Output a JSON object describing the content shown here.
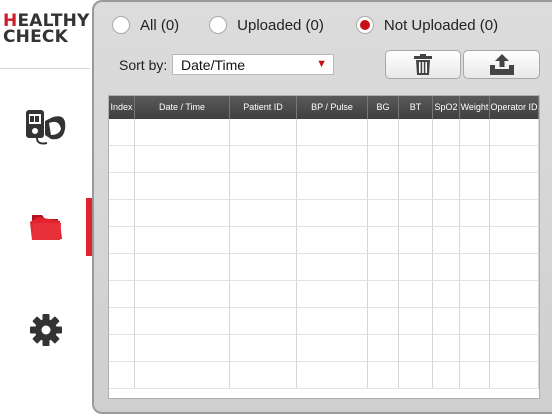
{
  "logo": {
    "first_letter": "H",
    "line1_rest": "EALTHY",
    "line2": "CHECK"
  },
  "nav": [
    {
      "name": "meter",
      "icon": "blood-pressure-meter-icon",
      "active": false
    },
    {
      "name": "records",
      "icon": "folder-icon",
      "active": true
    },
    {
      "name": "settings",
      "icon": "gear-icon",
      "active": false
    }
  ],
  "filters": {
    "all": "All (0)",
    "uploaded": "Uploaded (0)",
    "not_uploaded": "Not Uploaded (0)",
    "selected": "not_uploaded"
  },
  "sort": {
    "label": "Sort by:",
    "value": "Date/Time"
  },
  "toolbar": {
    "delete_icon": "trash-icon",
    "upload_icon": "upload-tray-icon"
  },
  "table": {
    "columns": [
      "Index",
      "Date / Time",
      "Patient ID",
      "BP / Pulse",
      "BG",
      "BT",
      "SpO2",
      "Weight",
      "Operator ID"
    ],
    "rows": []
  },
  "colors": {
    "accent": "#e0232f",
    "header": "#454545"
  }
}
